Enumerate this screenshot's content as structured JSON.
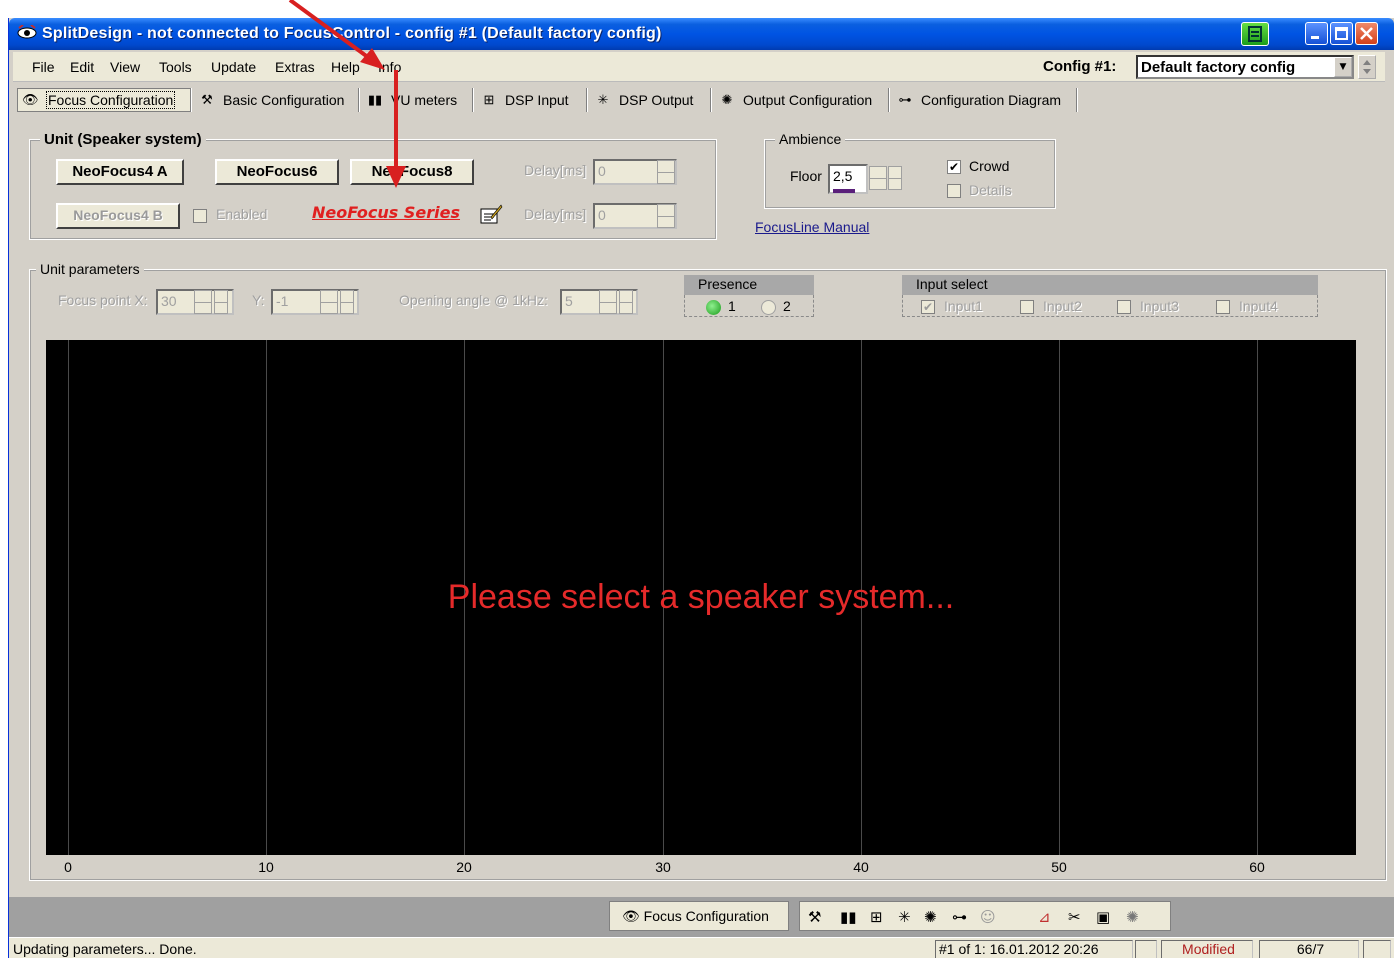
{
  "window": {
    "title": "SplitDesign - not connected to FocusControl  -  config #1 (Default factory config)"
  },
  "menu": {
    "items": [
      "File",
      "Edit",
      "View",
      "Tools",
      "Update",
      "Extras",
      "Help",
      "Info"
    ],
    "config_label": "Config #1:",
    "config_value": "Default factory config"
  },
  "tabs": [
    {
      "label": "Focus Configuration",
      "icon": "eye-icon"
    },
    {
      "label": "Basic Configuration",
      "icon": "hammer-icon"
    },
    {
      "label": "VU meters",
      "icon": "vu-meter-icon"
    },
    {
      "label": "DSP Input",
      "icon": "dsp-input-icon"
    },
    {
      "label": "DSP Output",
      "icon": "dsp-output-icon"
    },
    {
      "label": "Output Configuration",
      "icon": "gear-icon"
    },
    {
      "label": "Configuration Diagram",
      "icon": "diagram-icon"
    }
  ],
  "unit": {
    "title": "Unit (Speaker system)",
    "buttons": [
      "NeoFocus4 A",
      "NeoFocus6",
      "NeoFocus8"
    ],
    "button_b": "NeoFocus4 B",
    "enabled_label": "Enabled",
    "series_link": "NeoFocus Series",
    "delay_label": "Delay[ms]",
    "delay1": "0",
    "delay2": "0"
  },
  "ambience": {
    "title": "Ambience",
    "floor_label": "Floor",
    "floor_value": "2,5",
    "crowd_label": "Crowd",
    "crowd_checked": "✔",
    "details_label": "Details",
    "manual_link": "FocusLine Manual"
  },
  "unit_params": {
    "title": "Unit parameters",
    "focus_x_label": "Focus point X:",
    "focus_x_value": "30",
    "y_label": "Y:",
    "y_value": "-1",
    "angle_label": "Opening angle @ 1kHz:",
    "angle_value": "5",
    "presence_title": "Presence",
    "presence_opt1": "1",
    "presence_opt2": "2",
    "input_title": "Input select",
    "inputs": [
      "Input1",
      "Input2",
      "Input3",
      "Input4"
    ],
    "input1_checked": "✔"
  },
  "plot": {
    "message": "Please select a speaker system...",
    "ticks": [
      "0",
      "10",
      "20",
      "30",
      "40",
      "50",
      "60"
    ]
  },
  "bottom_bar": {
    "tab_label": "Focus Configuration"
  },
  "status": {
    "message": "Updating parameters...  Done.",
    "config_info": "#1 of 1: 16.01.2012 20:26",
    "modified": "Modified",
    "counter": "66/7"
  },
  "colors": {
    "title_blue": "#0054e3",
    "warning_red": "#e52a2a",
    "link_blue": "#1a1a8c",
    "plot_bg": "#000000"
  }
}
